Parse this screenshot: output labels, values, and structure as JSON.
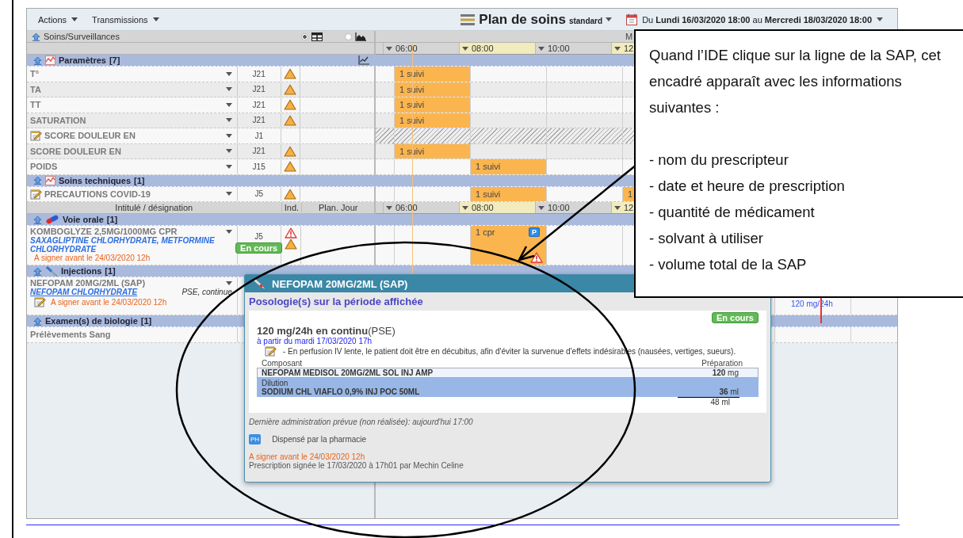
{
  "toolbar": {
    "menus": [
      "Actions",
      "Transmissions"
    ],
    "plan_title": "Plan de soins",
    "plan_mode": "standard",
    "period": "Du **Lundi 16/03/2020 18:00**  au **Mercredi 18/03/2020 18:00**"
  },
  "left_header": {
    "title": "Soins/Surveillances",
    "views": [
      {
        "kind": "table",
        "selected": true
      },
      {
        "kind": "chart",
        "selected": false
      }
    ]
  },
  "timeline": {
    "day": "M",
    "hours": [
      {
        "label": "06:00",
        "highlighted": false
      },
      {
        "label": "08:00",
        "highlighted": true
      },
      {
        "label": "10:00",
        "highlighted": false
      },
      {
        "label": "12",
        "highlighted": true
      }
    ]
  },
  "rows": [
    {
      "kind": "group",
      "title": "Paramètres",
      "count": "[7]",
      "icon": {
        "kind": "chart"
      },
      "graph_button": true
    },
    {
      "kind": "item",
      "name": "T°",
      "dropdown": true,
      "note": false,
      "day": "J21",
      "alerts": [
        {
          "kind": "warning"
        }
      ],
      "hatched": false,
      "cells": [
        {
          "text": "1 suivi"
        },
        null,
        null,
        null,
        null,
        null,
        null
      ]
    },
    {
      "kind": "item",
      "name": "TA",
      "dropdown": true,
      "note": false,
      "day": "J21",
      "alerts": [
        {
          "kind": "warning"
        }
      ],
      "hatched": false,
      "cells": [
        {
          "text": "1 suivi"
        },
        null,
        null,
        null,
        null,
        null,
        null
      ]
    },
    {
      "kind": "item",
      "name": "TT",
      "dropdown": true,
      "note": false,
      "day": "J21",
      "alerts": [
        {
          "kind": "warning"
        }
      ],
      "hatched": false,
      "cells": [
        {
          "text": "1 suivi"
        },
        null,
        null,
        null,
        null,
        null,
        null
      ]
    },
    {
      "kind": "item",
      "name": "SATURATION",
      "dropdown": true,
      "note": false,
      "day": "J21",
      "alerts": [
        {
          "kind": "warning"
        }
      ],
      "hatched": false,
      "cells": [
        {
          "text": "1 suivi"
        },
        null,
        null,
        null,
        null,
        null,
        null
      ]
    },
    {
      "kind": "item",
      "name": "SCORE DOULEUR EN",
      "dropdown": true,
      "note": true,
      "day": "J1",
      "alerts": [],
      "hatched": true,
      "cells": [
        null,
        null,
        null,
        null,
        null,
        null,
        null
      ]
    },
    {
      "kind": "item",
      "name": "SCORE DOULEUR EN",
      "dropdown": true,
      "note": false,
      "day": "J21",
      "alerts": [
        {
          "kind": "warning"
        }
      ],
      "hatched": false,
      "cells": [
        {
          "text": "1 suivi"
        },
        null,
        null,
        null,
        null,
        null,
        null
      ]
    },
    {
      "kind": "item",
      "name": "POIDS",
      "dropdown": true,
      "note": false,
      "day": "J15",
      "alerts": [
        {
          "kind": "warning"
        }
      ],
      "hatched": false,
      "cells": [
        null,
        {
          "text": "1 suivi"
        },
        null,
        null,
        null,
        null,
        null
      ]
    },
    {
      "kind": "group",
      "title": "Soins techniques",
      "count": "[1]",
      "icon": {
        "kind": "chart"
      },
      "graph_button": false
    },
    {
      "kind": "item",
      "name": "PRECAUTIONS COVID-19",
      "dropdown": true,
      "note": true,
      "day": "J5",
      "alerts": [
        {
          "kind": "warning"
        }
      ],
      "hatched": false,
      "cells": [
        null,
        {
          "text": "1 suivi"
        },
        null,
        {
          "text": "1"
        },
        null,
        null,
        null
      ]
    },
    {
      "kind": "header",
      "label": "Intitulé / désignation",
      "ind": "Ind.",
      "plan": "Plan. Jour",
      "hours": [
        {
          "label": "06:00",
          "highlighted": false
        },
        {
          "label": "08:00",
          "highlighted": true
        },
        {
          "label": "10:00",
          "highlighted": false
        },
        {
          "label": "12",
          "highlighted": true
        }
      ]
    },
    {
      "kind": "group",
      "title": "Voie orale",
      "count": "[1]",
      "icon": {
        "kind": "pill"
      },
      "graph_button": false
    },
    {
      "kind": "drug",
      "name": "KOMBOGLYZE 2,5MG/1000MG CPR",
      "dropdown": true,
      "generic": "SAXAGLIPTINE CHLORHYDRATE, METFORMINE CHLORHYDRATE",
      "generic_link": false,
      "note": false,
      "sign_before": "A signer avant le 24/03/2020 12h",
      "day": "J5",
      "status": "En cours",
      "alerts": [
        {
          "kind": "danger"
        },
        {
          "kind": "warning"
        }
      ],
      "cells": [
        null,
        {
          "text": "1 cpr",
          "badge": "P",
          "alert": {
            "kind": "danger"
          }
        },
        null,
        null,
        null,
        null,
        null
      ]
    },
    {
      "kind": "group",
      "title": "Injections",
      "count": "[1]",
      "icon": {
        "kind": "syringe"
      },
      "graph_button": false
    },
    {
      "kind": "drug",
      "name": "NEFOPAM 20MG/2ML  (SAP)",
      "dropdown": true,
      "generic": "NEFOPAM CHLORHYDRATE",
      "generic_link": true,
      "route": "PSE, continue",
      "note": true,
      "sign_before": "A signer avant le 24/03/2020 12h",
      "alerts": [],
      "cells": [
        null,
        null,
        null,
        null,
        null,
        {
          "text": "120 mg/24h",
          "kind": "dose"
        },
        null
      ]
    },
    {
      "kind": "group",
      "title": "Examen(s) de biologie",
      "count": "[1]",
      "graph_button": false
    },
    {
      "kind": "item",
      "name": "Prélèvements Sang",
      "dropdown": false,
      "note": false,
      "alerts": [],
      "hatched": false,
      "cells": [
        null,
        null,
        null,
        null,
        null,
        null,
        null
      ]
    }
  ],
  "popup": {
    "title": "NEFOPAM 20MG/2ML (SAP)",
    "section": "Posologie(s) sur la période affichée",
    "status": "En cours",
    "dose": "**120 mg/24h en continu**(PSE)",
    "start": "à partir du mardi 17/03/2020 17h",
    "note": "- En perfusion IV lente, le patient doit être en décubitus, afin d'éviter la survenue d'effets indésirables (nausées, vertiges, sueurs).",
    "col_component": "Composant",
    "col_prep": "Préparation",
    "components": [
      {
        "kind": "component",
        "name": "NEFOPAM MEDISOL 20MG/2ML  SOL INJ AMP",
        "qty": "120",
        "unit": "mg"
      },
      {
        "kind": "dilution",
        "label": "Dilution",
        "name": "SODIUM CHL VIAFLO 0,9% INJ POC 50ML",
        "qty": "36",
        "unit": "ml"
      }
    ],
    "total": "48 ml",
    "last_admin": "Dernière administration prévue (non réalisée): aujourd'hui 17:00",
    "dispensed_badge": "PH",
    "dispensed": "Dispensé par la pharmacie",
    "sign_before": "A signer avant le 24/03/2020 12h",
    "signed": "Prescription signée le 17/03/2020 à 17h01 par Mechin Celine"
  },
  "callout": {
    "text": "Quand l’IDE clique sur la ligne de la SAP, cet encadré apparaît avec les informations suivantes :",
    "items": [
      "-  nom du prescripteur",
      "-  date et heure de prescription",
      "-  quantité de médicament",
      "-  solvant à utiliser",
      "- volume total de la SAP"
    ]
  }
}
